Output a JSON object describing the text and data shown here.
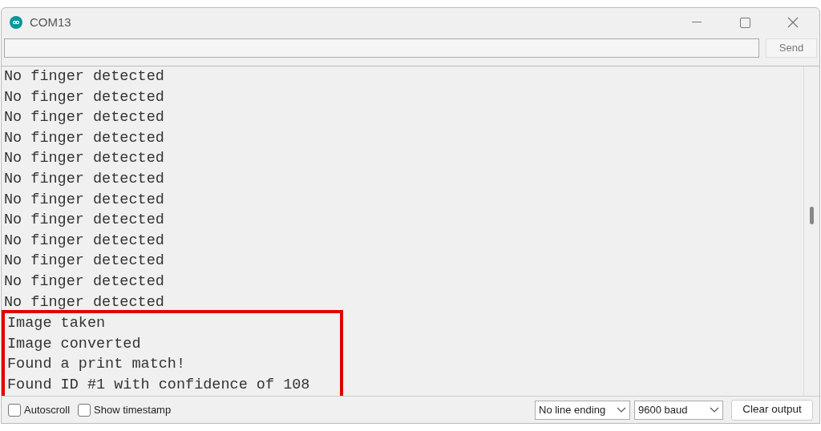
{
  "window": {
    "title": "COM13"
  },
  "send_button": "Send",
  "output_lines": [
    {
      "text": "No finger detected",
      "highlighted": false
    },
    {
      "text": "No finger detected",
      "highlighted": false
    },
    {
      "text": "No finger detected",
      "highlighted": false
    },
    {
      "text": "No finger detected",
      "highlighted": false
    },
    {
      "text": "No finger detected",
      "highlighted": false
    },
    {
      "text": "No finger detected",
      "highlighted": false
    },
    {
      "text": "No finger detected",
      "highlighted": false
    },
    {
      "text": "No finger detected",
      "highlighted": false
    },
    {
      "text": "No finger detected",
      "highlighted": false
    },
    {
      "text": "No finger detected",
      "highlighted": false
    },
    {
      "text": "No finger detected",
      "highlighted": false
    },
    {
      "text": "No finger detected",
      "highlighted": false
    },
    {
      "text": "Image taken",
      "highlighted": true
    },
    {
      "text": "Image converted",
      "highlighted": true
    },
    {
      "text": "Found a print match!",
      "highlighted": true
    },
    {
      "text": "Found ID #1 with confidence of 108",
      "highlighted": true
    }
  ],
  "options": [
    {
      "label": "Autoscroll",
      "checked": false
    },
    {
      "label": "Show timestamp",
      "checked": false
    }
  ],
  "line_ending": "No line ending",
  "baud": "9600 baud",
  "clear_button": "Clear output"
}
